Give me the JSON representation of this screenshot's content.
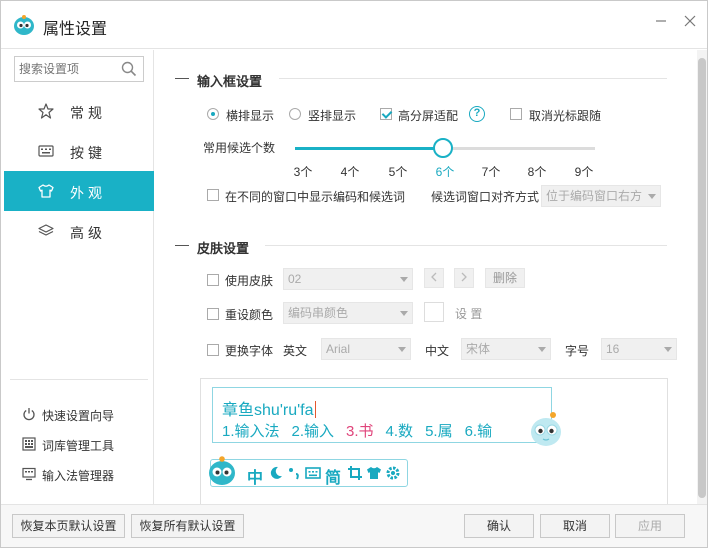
{
  "window": {
    "title": "属性设置",
    "minimize_icon": "minimize-icon",
    "close_icon": "close-icon"
  },
  "sidebar": {
    "search_placeholder": "搜索设置项",
    "items": [
      {
        "label": "常规",
        "icon": "star-icon",
        "active": false
      },
      {
        "label": "按键",
        "icon": "keyboard-icon",
        "active": false
      },
      {
        "label": "外观",
        "icon": "tshirt-icon",
        "active": true
      },
      {
        "label": "高级",
        "icon": "layers-icon",
        "active": false
      }
    ],
    "links": [
      {
        "label": "快速设置向导",
        "icon": "power-icon"
      },
      {
        "label": "词库管理工具",
        "icon": "grid-icon"
      },
      {
        "label": "输入法管理器",
        "icon": "monitor-icon"
      }
    ]
  },
  "input_box": {
    "section_title": "输入框设置",
    "horizontal_label": "横排显示",
    "vertical_label": "竖排显示",
    "orientation_selected": "横排显示",
    "hidpi_label": "高分屏适配",
    "hidpi_checked": true,
    "help_icon_text": "?",
    "cancel_cursor_follow_label": "取消光标跟随",
    "cancel_cursor_follow_checked": false,
    "candidates_label": "常用候选个数",
    "candidate_ticks": [
      "3个",
      "4个",
      "5个",
      "6个",
      "7个",
      "8个",
      "9个"
    ],
    "candidate_selected": "6个",
    "show_in_diff_window_label": "在不同的窗口中显示编码和候选词",
    "show_in_diff_window_checked": false,
    "align_label": "候选词窗口对齐方式",
    "align_value": "位于编码窗口右方"
  },
  "skin": {
    "section_title": "皮肤设置",
    "use_skin_label": "使用皮肤",
    "use_skin_value": "02",
    "delete_label": "删除",
    "reset_color_label": "重设颜色",
    "reset_color_value": "编码串颜色",
    "set_label": "设 置",
    "change_font_label": "更换字体",
    "english_label": "英文",
    "english_font": "Arial",
    "chinese_label": "中文",
    "chinese_font": "宋体",
    "size_label": "字号",
    "size_value": "16"
  },
  "preview": {
    "composition_prefix": "章鱼",
    "composition_text": "shu'ru'fa",
    "candidates": [
      "1.输入法",
      "2.输入",
      "3.书",
      "4.数",
      "5.属",
      "6.输"
    ],
    "highlight_index": 2,
    "status_icons": [
      "mascot-icon",
      "中",
      "moon-icon",
      "punct-icon",
      "keyboard-icon",
      "简",
      "crop-icon",
      "tshirt-icon",
      "gear-icon"
    ]
  },
  "footer": {
    "restore_page": "恢复本页默认设置",
    "restore_all": "恢复所有默认设置",
    "ok": "确认",
    "cancel": "取消",
    "apply": "应用"
  },
  "colors": {
    "accent": "#19b1c6",
    "highlight": "#e0457b"
  }
}
